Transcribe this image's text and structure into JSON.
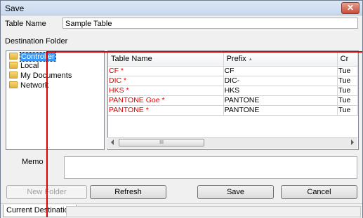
{
  "window": {
    "title": "Save",
    "close_glyph": "✕"
  },
  "form": {
    "table_name_label": "Table Name",
    "table_name_value": "Sample Table",
    "destination_label": "Destination Folder",
    "memo_label": "Memo"
  },
  "tree": {
    "items": [
      {
        "label": "Controller",
        "icon": "folder-icon",
        "selected": true
      },
      {
        "label": "Local",
        "icon": "folder-icon",
        "selected": false
      },
      {
        "label": "My Documents",
        "icon": "folder-icon",
        "selected": false
      },
      {
        "label": "Network",
        "icon": "folder-icon",
        "selected": false
      }
    ]
  },
  "grid": {
    "columns": [
      "Table Name",
      "Prefix",
      "Cr"
    ],
    "sort_glyph": "▲",
    "rows": [
      {
        "name": "CF  *",
        "prefix": "CF",
        "created": "Tue"
      },
      {
        "name": "DIC  *",
        "prefix": "DIC-",
        "created": "Tue"
      },
      {
        "name": "HKS  *",
        "prefix": "HKS",
        "created": "Tue"
      },
      {
        "name": "PANTONE Goe  *",
        "prefix": "PANTONE",
        "created": "Tue"
      },
      {
        "name": "PANTONE  *",
        "prefix": "PANTONE",
        "created": "Tue"
      }
    ],
    "scroll_grip": "III"
  },
  "buttons": {
    "new_folder": "New Folder",
    "refresh": "Refresh",
    "save": "Save",
    "cancel": "Cancel"
  },
  "status": {
    "current_destination": "Current Destination"
  },
  "colors": {
    "accent_red": "#e00000",
    "selection": "#3399ff"
  }
}
